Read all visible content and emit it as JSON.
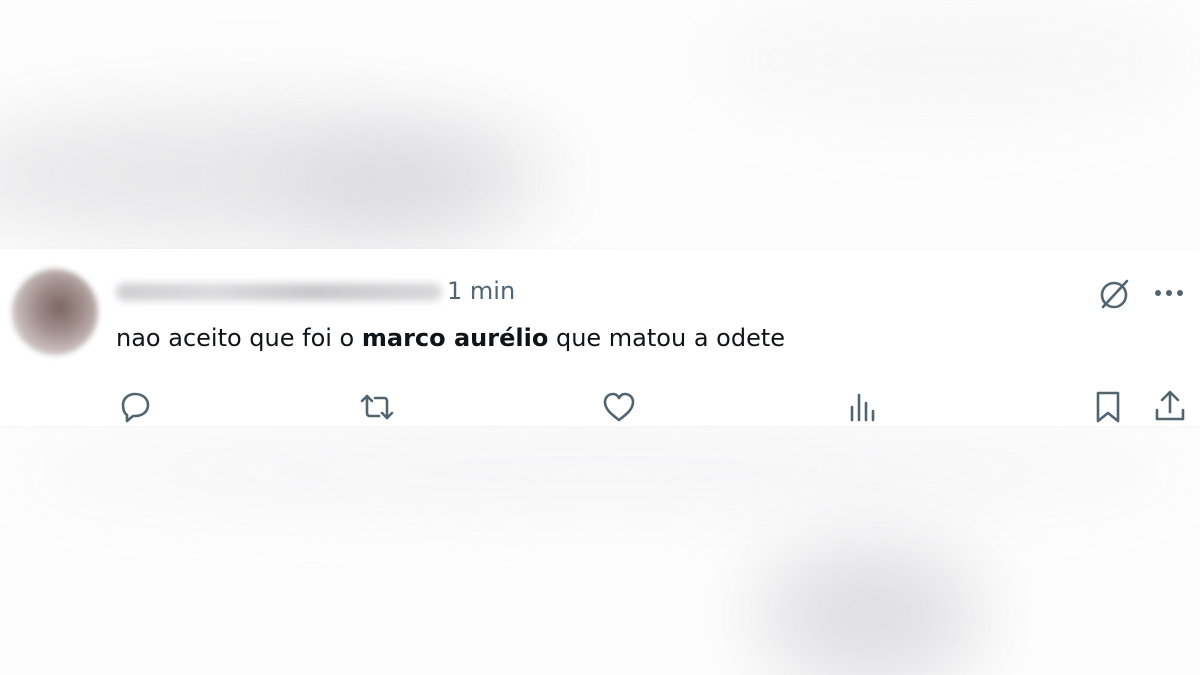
{
  "post": {
    "timestamp": "1 min",
    "text_before": "nao aceito que foi o ",
    "text_bold": "marco aurélio",
    "text_after": " que matou a odete"
  },
  "icons": {
    "reply": "reply-icon",
    "retweet": "retweet-icon",
    "like": "heart-icon",
    "views": "views-icon",
    "bookmark": "bookmark-icon",
    "share": "share-icon",
    "grok": "grok-icon",
    "more": "more-icon"
  },
  "colors": {
    "text": "#0f1419",
    "muted": "#536471"
  }
}
